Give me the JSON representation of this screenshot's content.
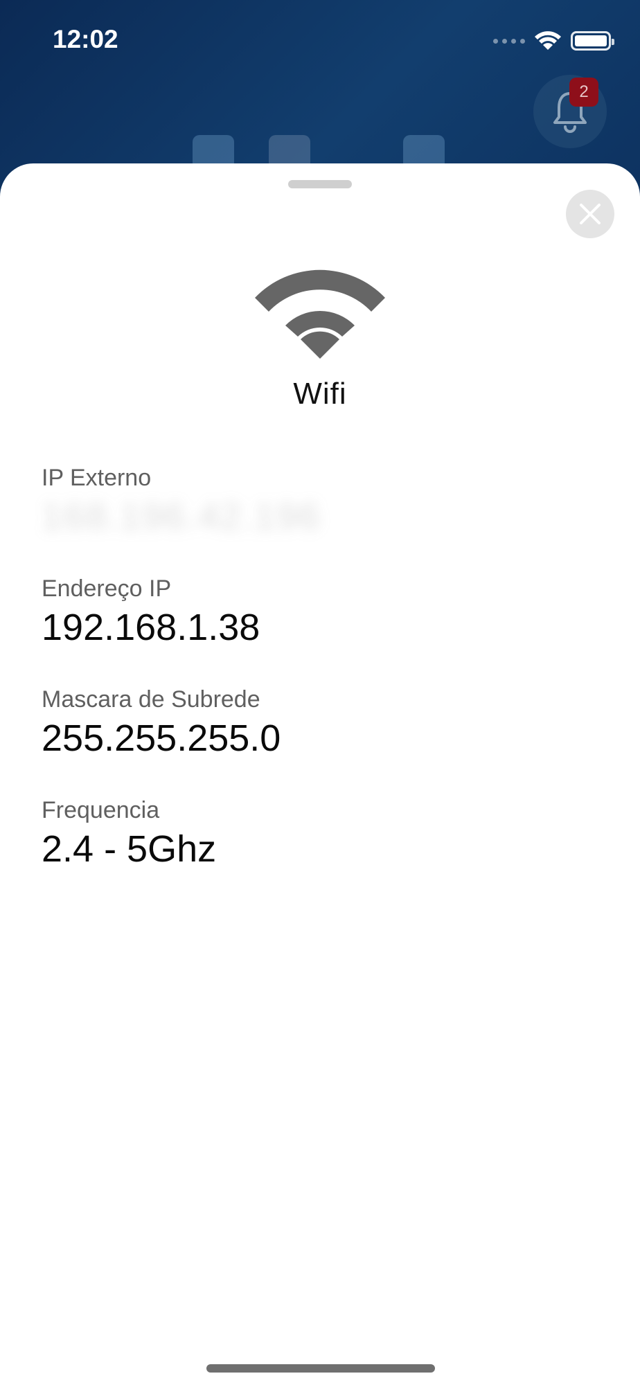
{
  "status_bar": {
    "time": "12:02"
  },
  "background": {
    "notifications_badge": "2",
    "gradient_colors": [
      "#0b2a55",
      "#123e6e"
    ]
  },
  "sheet": {
    "title": "Wifi",
    "hero_icon": "wifi-icon",
    "close_icon": "close-icon",
    "fields": [
      {
        "label": "IP Externo",
        "value": "168.196.42.196"
      },
      {
        "label": "Endereço IP",
        "value": "192.168.1.38"
      },
      {
        "label": "Mascara de Subrede",
        "value": "255.255.255.0"
      },
      {
        "label": "Frequencia",
        "value": "2.4 - 5Ghz"
      }
    ]
  },
  "colors": {
    "label": "#5f5f5f",
    "value": "#0a0a0a",
    "icon": "#666666",
    "badge": "#8e0f1a"
  }
}
